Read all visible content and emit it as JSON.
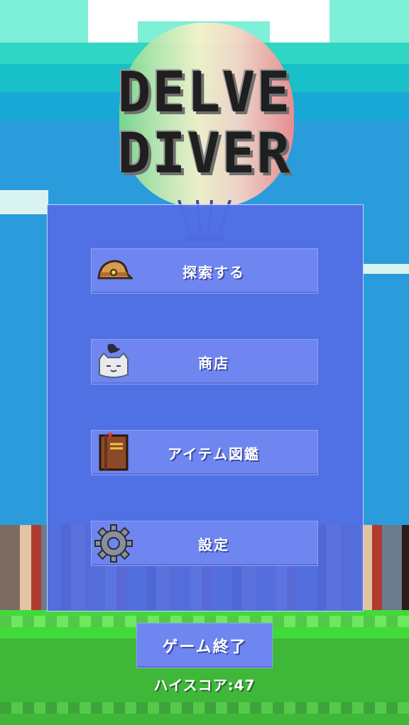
{
  "title": {
    "line1": "DELVE",
    "line2": "DIVER"
  },
  "menu": {
    "explore_label": "探索する",
    "shop_label": "商店",
    "items_label": "アイテム図鑑",
    "settings_label": "設定",
    "icons": {
      "explore": "explorer-hat-icon",
      "shop": "cat-merchant-icon",
      "items": "book-icon",
      "settings": "gear-icon"
    }
  },
  "quit_label": "ゲーム終了",
  "highscore": {
    "label": "ハイスコア:",
    "value": "47"
  },
  "colors": {
    "panel": "#526ee4",
    "button": "#6f86f0",
    "sky": "#2a9cdc",
    "grass": "#42d93b",
    "text": "#ffffff"
  }
}
